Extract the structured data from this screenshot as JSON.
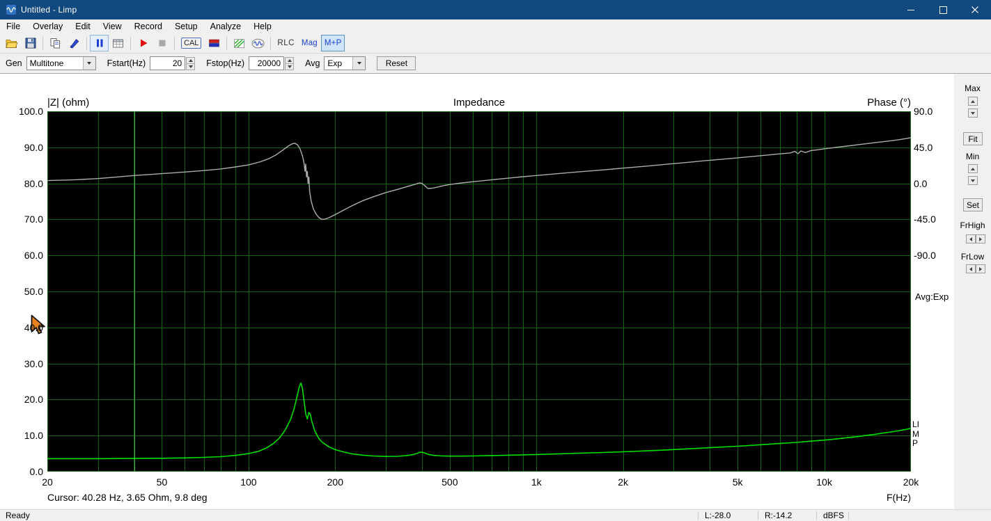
{
  "window": {
    "title": "Untitled - Limp"
  },
  "menu": {
    "items": [
      "File",
      "Overlay",
      "Edit",
      "View",
      "Record",
      "Setup",
      "Analyze",
      "Help"
    ]
  },
  "toolbar": {
    "cal_label": "CAL",
    "rlc_label": "RLC",
    "mag_label": "Mag",
    "mp_label": "M+P"
  },
  "genbar": {
    "gen_label": "Gen",
    "gen_value": "Multitone",
    "fstart_label": "Fstart(Hz)",
    "fstart_value": "20",
    "fstop_label": "Fstop(Hz)",
    "fstop_value": "20000",
    "avg_label": "Avg",
    "avg_value": "Exp",
    "reset_label": "Reset"
  },
  "chart": {
    "title": "Impedance",
    "left_axis_label": "|Z| (ohm)",
    "right_axis_label": "Phase (°)",
    "x_axis_label": "F(Hz)",
    "left_ticks": [
      "100.0",
      "90.0",
      "80.0",
      "70.0",
      "60.0",
      "50.0",
      "40.0",
      "30.0",
      "20.0",
      "10.0",
      "0.0"
    ],
    "right_ticks": [
      "90.0",
      "45.0",
      "0.0",
      "-45.0",
      "-90.0"
    ],
    "x_ticks": [
      "20",
      "50",
      "100",
      "200",
      "500",
      "1k",
      "2k",
      "5k",
      "10k",
      "20k"
    ],
    "cursor_text": "Cursor: 40.28 Hz, 3.65 Ohm, 9.8 deg",
    "avg_display": "Avg:Exp",
    "watermark": "LIMP"
  },
  "side_panel": {
    "max": "Max",
    "fit": "Fit",
    "min": "Min",
    "set": "Set",
    "frhigh": "FrHigh",
    "frlow": "FrLow"
  },
  "status_bar": {
    "ready": "Ready",
    "left_level": "L:-28.0",
    "right_level": "R:-14.2",
    "unit": "dBFS"
  },
  "chart_data": {
    "type": "line",
    "title": "Impedance",
    "x_scale": "log",
    "x_range_hz": [
      20,
      20000
    ],
    "x_ticks_hz": [
      20,
      50,
      100,
      200,
      500,
      1000,
      2000,
      5000,
      10000,
      20000
    ],
    "left_axis": {
      "label": "|Z| (ohm)",
      "range_ohm": [
        0,
        100
      ],
      "grid_step_ohm": 10
    },
    "right_axis": {
      "label": "Phase (°)",
      "range_deg": [
        -90,
        90
      ],
      "maps_to_left_ohm": [
        60,
        100
      ]
    },
    "grid": {
      "color": "#0e6412",
      "log_minor_lines": true
    },
    "cursor": {
      "freq_hz": 40.28,
      "impedance_ohm": 3.65,
      "phase_deg": 9.8,
      "color": "#55a555"
    },
    "series": [
      {
        "name": "impedance_ohm",
        "axis": "left",
        "color": "#00e000",
        "width": 1.6,
        "points": [
          [
            20,
            3.6
          ],
          [
            25,
            3.6
          ],
          [
            30,
            3.6
          ],
          [
            35,
            3.62
          ],
          [
            40,
            3.65
          ],
          [
            45,
            3.68
          ],
          [
            50,
            3.7
          ],
          [
            60,
            3.8
          ],
          [
            70,
            3.95
          ],
          [
            80,
            4.15
          ],
          [
            90,
            4.5
          ],
          [
            100,
            5.0
          ],
          [
            108,
            5.6
          ],
          [
            115,
            6.5
          ],
          [
            122,
            7.8
          ],
          [
            128,
            9.3
          ],
          [
            134,
            11.5
          ],
          [
            140,
            14.5
          ],
          [
            144,
            17.5
          ],
          [
            147,
            20.5
          ],
          [
            150,
            23.5
          ],
          [
            152,
            24.6
          ],
          [
            154,
            23.0
          ],
          [
            156,
            19.5
          ],
          [
            158,
            16.0
          ],
          [
            160,
            14.6
          ],
          [
            162,
            16.4
          ],
          [
            164,
            15.8
          ],
          [
            166,
            13.8
          ],
          [
            170,
            11.2
          ],
          [
            175,
            9.3
          ],
          [
            180,
            8.2
          ],
          [
            190,
            6.9
          ],
          [
            200,
            6.1
          ],
          [
            215,
            5.4
          ],
          [
            230,
            4.9
          ],
          [
            250,
            4.55
          ],
          [
            270,
            4.35
          ],
          [
            300,
            4.2
          ],
          [
            330,
            4.25
          ],
          [
            360,
            4.5
          ],
          [
            380,
            4.9
          ],
          [
            395,
            5.4
          ],
          [
            405,
            5.3
          ],
          [
            420,
            4.8
          ],
          [
            440,
            4.5
          ],
          [
            470,
            4.35
          ],
          [
            500,
            4.3
          ],
          [
            550,
            4.3
          ],
          [
            600,
            4.35
          ],
          [
            700,
            4.45
          ],
          [
            800,
            4.55
          ],
          [
            900,
            4.65
          ],
          [
            1000,
            4.75
          ],
          [
            1200,
            4.95
          ],
          [
            1400,
            5.1
          ],
          [
            1700,
            5.3
          ],
          [
            2000,
            5.5
          ],
          [
            2400,
            5.75
          ],
          [
            2800,
            6.0
          ],
          [
            3300,
            6.3
          ],
          [
            4000,
            6.65
          ],
          [
            5000,
            7.05
          ],
          [
            6000,
            7.45
          ],
          [
            7000,
            7.8
          ],
          [
            8000,
            8.1
          ],
          [
            9000,
            8.45
          ],
          [
            10000,
            8.75
          ],
          [
            11000,
            9.05
          ],
          [
            12000,
            9.4
          ],
          [
            13000,
            9.7
          ],
          [
            14000,
            10.05
          ],
          [
            15000,
            10.35
          ],
          [
            16000,
            10.7
          ],
          [
            17000,
            11.0
          ],
          [
            18000,
            11.3
          ],
          [
            19000,
            11.65
          ],
          [
            20000,
            12.0
          ]
        ]
      },
      {
        "name": "phase_deg",
        "axis": "right",
        "color": "#adadad",
        "width": 1.4,
        "points": [
          [
            20,
            3.5
          ],
          [
            25,
            4.5
          ],
          [
            30,
            6
          ],
          [
            35,
            8
          ],
          [
            40,
            9.8
          ],
          [
            45,
            11
          ],
          [
            50,
            12.2
          ],
          [
            60,
            14.2
          ],
          [
            70,
            16
          ],
          [
            80,
            18
          ],
          [
            90,
            20.5
          ],
          [
            100,
            23
          ],
          [
            110,
            27
          ],
          [
            118,
            31
          ],
          [
            125,
            36
          ],
          [
            132,
            42
          ],
          [
            138,
            47
          ],
          [
            142,
            49.5
          ],
          [
            145,
            50
          ],
          [
            148,
            48
          ],
          [
            151,
            43
          ],
          [
            154,
            34
          ],
          [
            156,
            25
          ],
          [
            157,
            15
          ],
          [
            158,
            24
          ],
          [
            159,
            8
          ],
          [
            160,
            15
          ],
          [
            161,
            0
          ],
          [
            162,
            8
          ],
          [
            163,
            -10
          ],
          [
            165,
            -22
          ],
          [
            168,
            -32
          ],
          [
            172,
            -39
          ],
          [
            176,
            -43
          ],
          [
            180,
            -45
          ],
          [
            185,
            -44.5
          ],
          [
            190,
            -43
          ],
          [
            200,
            -39
          ],
          [
            215,
            -33
          ],
          [
            230,
            -27.5
          ],
          [
            250,
            -21.5
          ],
          [
            270,
            -17
          ],
          [
            300,
            -11.5
          ],
          [
            330,
            -7.5
          ],
          [
            360,
            -3.5
          ],
          [
            380,
            -1
          ],
          [
            392,
            0.5
          ],
          [
            400,
            0
          ],
          [
            410,
            -3
          ],
          [
            420,
            -6.5
          ],
          [
            435,
            -6
          ],
          [
            455,
            -4.5
          ],
          [
            480,
            -2.5
          ],
          [
            500,
            -1.5
          ],
          [
            550,
            0.5
          ],
          [
            600,
            2
          ],
          [
            700,
            4.5
          ],
          [
            800,
            6.5
          ],
          [
            900,
            8.3
          ],
          [
            1000,
            9.8
          ],
          [
            1200,
            12.3
          ],
          [
            1400,
            14.3
          ],
          [
            1700,
            16.8
          ],
          [
            2000,
            19
          ],
          [
            2400,
            21.5
          ],
          [
            2800,
            23.7
          ],
          [
            3300,
            26
          ],
          [
            4000,
            28.8
          ],
          [
            4700,
            31
          ],
          [
            5500,
            33.3
          ],
          [
            6300,
            35.2
          ],
          [
            7000,
            36.8
          ],
          [
            7600,
            38
          ],
          [
            7900,
            40
          ],
          [
            8100,
            37
          ],
          [
            8300,
            40.5
          ],
          [
            8600,
            38.5
          ],
          [
            9000,
            41
          ],
          [
            9500,
            42
          ],
          [
            10000,
            43.2
          ],
          [
            11000,
            45
          ],
          [
            12000,
            46.6
          ],
          [
            13000,
            48.1
          ],
          [
            14000,
            49.5
          ],
          [
            15000,
            50.8
          ],
          [
            16000,
            52
          ],
          [
            17000,
            53.2
          ],
          [
            18000,
            54.3
          ],
          [
            19000,
            55.6
          ],
          [
            20000,
            57
          ]
        ]
      }
    ]
  }
}
